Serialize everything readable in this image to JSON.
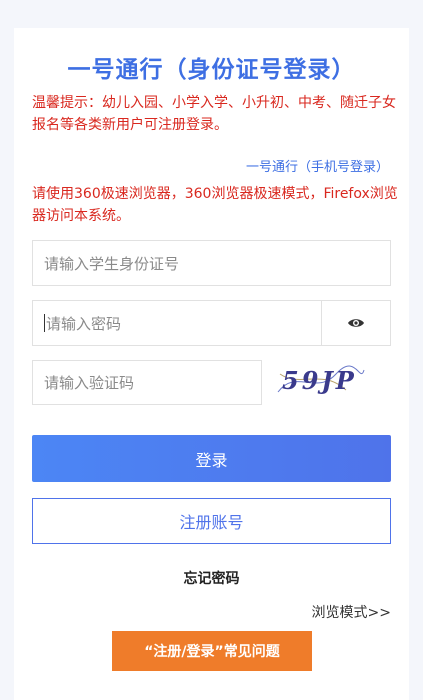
{
  "title": "一号通行（身份证号登录）",
  "notice": "温馨提示：幼儿入园、小学入学、小升初、中考、随迁子女报名等各类新用户可注册登录。",
  "phone_login_link": "一号通行（手机号登录）",
  "browser_notice": "请使用360极速浏览器，360浏览器极速模式，Firefox浏览器访问本系统。",
  "form": {
    "id_placeholder": "请输入学生身份证号",
    "password_placeholder": "请输入密码",
    "captcha_placeholder": "请输入验证码",
    "captcha_text": "59JP",
    "password_toggle_icon": "eye-icon"
  },
  "buttons": {
    "login": "登录",
    "register": "注册账号",
    "forgot": "忘记密码",
    "browse_mode": "浏览模式>>",
    "faq": "“注册/登录”常见问题"
  },
  "colors": {
    "accent": "#3e6fe3",
    "warning_text": "#d9281f",
    "faq_button": "#ef7c2a"
  }
}
